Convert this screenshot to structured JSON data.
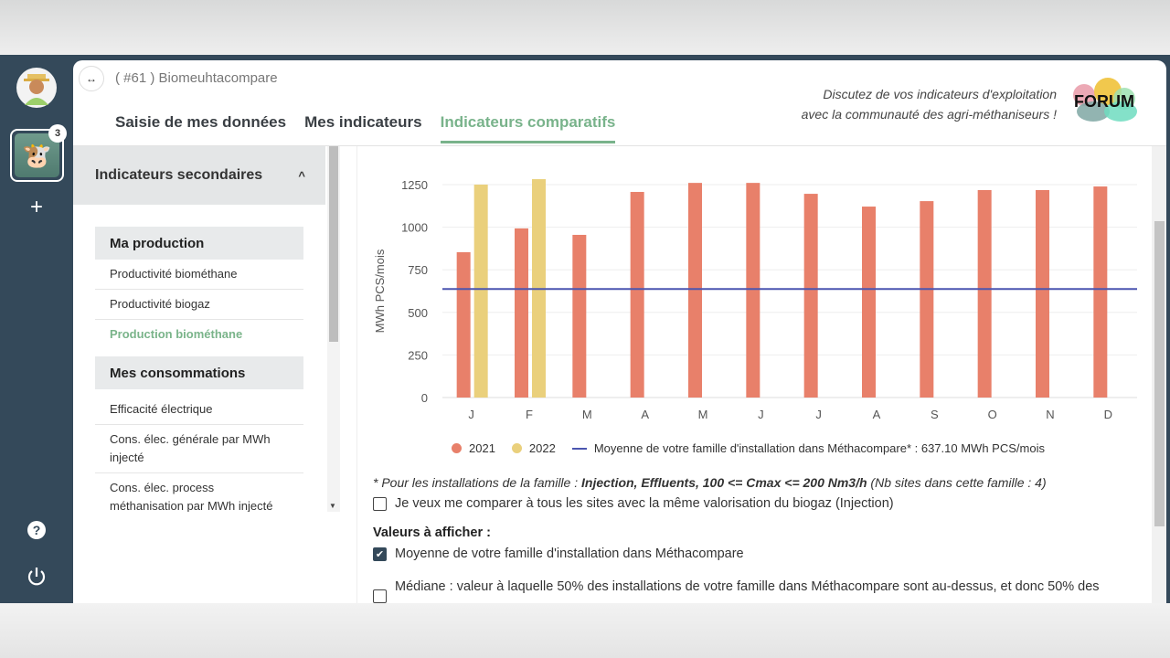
{
  "app": {
    "title": "( #61 ) Biomeuhtacompare",
    "notification_count": "3"
  },
  "tabs": [
    {
      "label": "Saisie de mes données"
    },
    {
      "label": "Mes indicateurs"
    },
    {
      "label": "Indicateurs comparatifs",
      "active": true
    }
  ],
  "forum": {
    "line1": "Discutez de vos indicateurs d'exploitation",
    "line2": "avec la communauté des agri-méthaniseurs !",
    "logo_text": "FORUM"
  },
  "left": {
    "section": "Indicateurs secondaires",
    "groups": [
      {
        "title": "Ma production",
        "items": [
          "Productivité biométhane",
          "Productivité biogaz",
          "Production biométhane"
        ],
        "active": "Production biométhane"
      },
      {
        "title": "Mes consommations",
        "items": [
          "Efficacité électrique",
          "Cons. élec. générale par MWh injecté",
          "Cons. élec. process méthanisation par MWh injecté"
        ]
      }
    ]
  },
  "chart_data": {
    "type": "bar",
    "ylabel": "MWh PCS/mois",
    "ylim": [
      0,
      1300
    ],
    "yticks": [
      0,
      250,
      500,
      750,
      1000,
      1250
    ],
    "grid": true,
    "legend": "bottom",
    "categories": [
      "J",
      "F",
      "M",
      "A",
      "M",
      "J",
      "J",
      "A",
      "S",
      "O",
      "N",
      "D"
    ],
    "series": [
      {
        "name": "2021",
        "color": "#e8806a",
        "values": [
          853,
          993,
          955,
          1207,
          1260,
          1260,
          1196,
          1121,
          1153,
          1218,
          1218,
          1239
        ]
      },
      {
        "name": "2022",
        "color": "#ead07c",
        "values": [
          1250,
          1282,
          null,
          null,
          null,
          null,
          null,
          null,
          null,
          null,
          null,
          null
        ]
      }
    ],
    "reference_line": {
      "name": "Moyenne de votre famille d'installation dans Méthacompare* : 637.10 MWh PCS/mois",
      "value": 637.1,
      "color": "#4b55b0"
    }
  },
  "note": {
    "prefix": "* Pour les installations de la famille : ",
    "bold": "Injection, Effluents, 100 <= Cmax <= 200 Nm3/h",
    "suffix": "  (Nb sites dans cette famille : 4)"
  },
  "options": {
    "compare_all": "Je veux me comparer à tous les sites avec la même valorisation du biogaz (Injection)",
    "values_title": "Valeurs à afficher :",
    "mean": "Moyenne de votre famille d'installation dans Méthacompare",
    "mean_checked": true,
    "median": "Médiane : valeur à laquelle 50% des installations de votre famille dans Méthacompare sont au-dessus, et donc 50% des",
    "median_checked": false
  }
}
